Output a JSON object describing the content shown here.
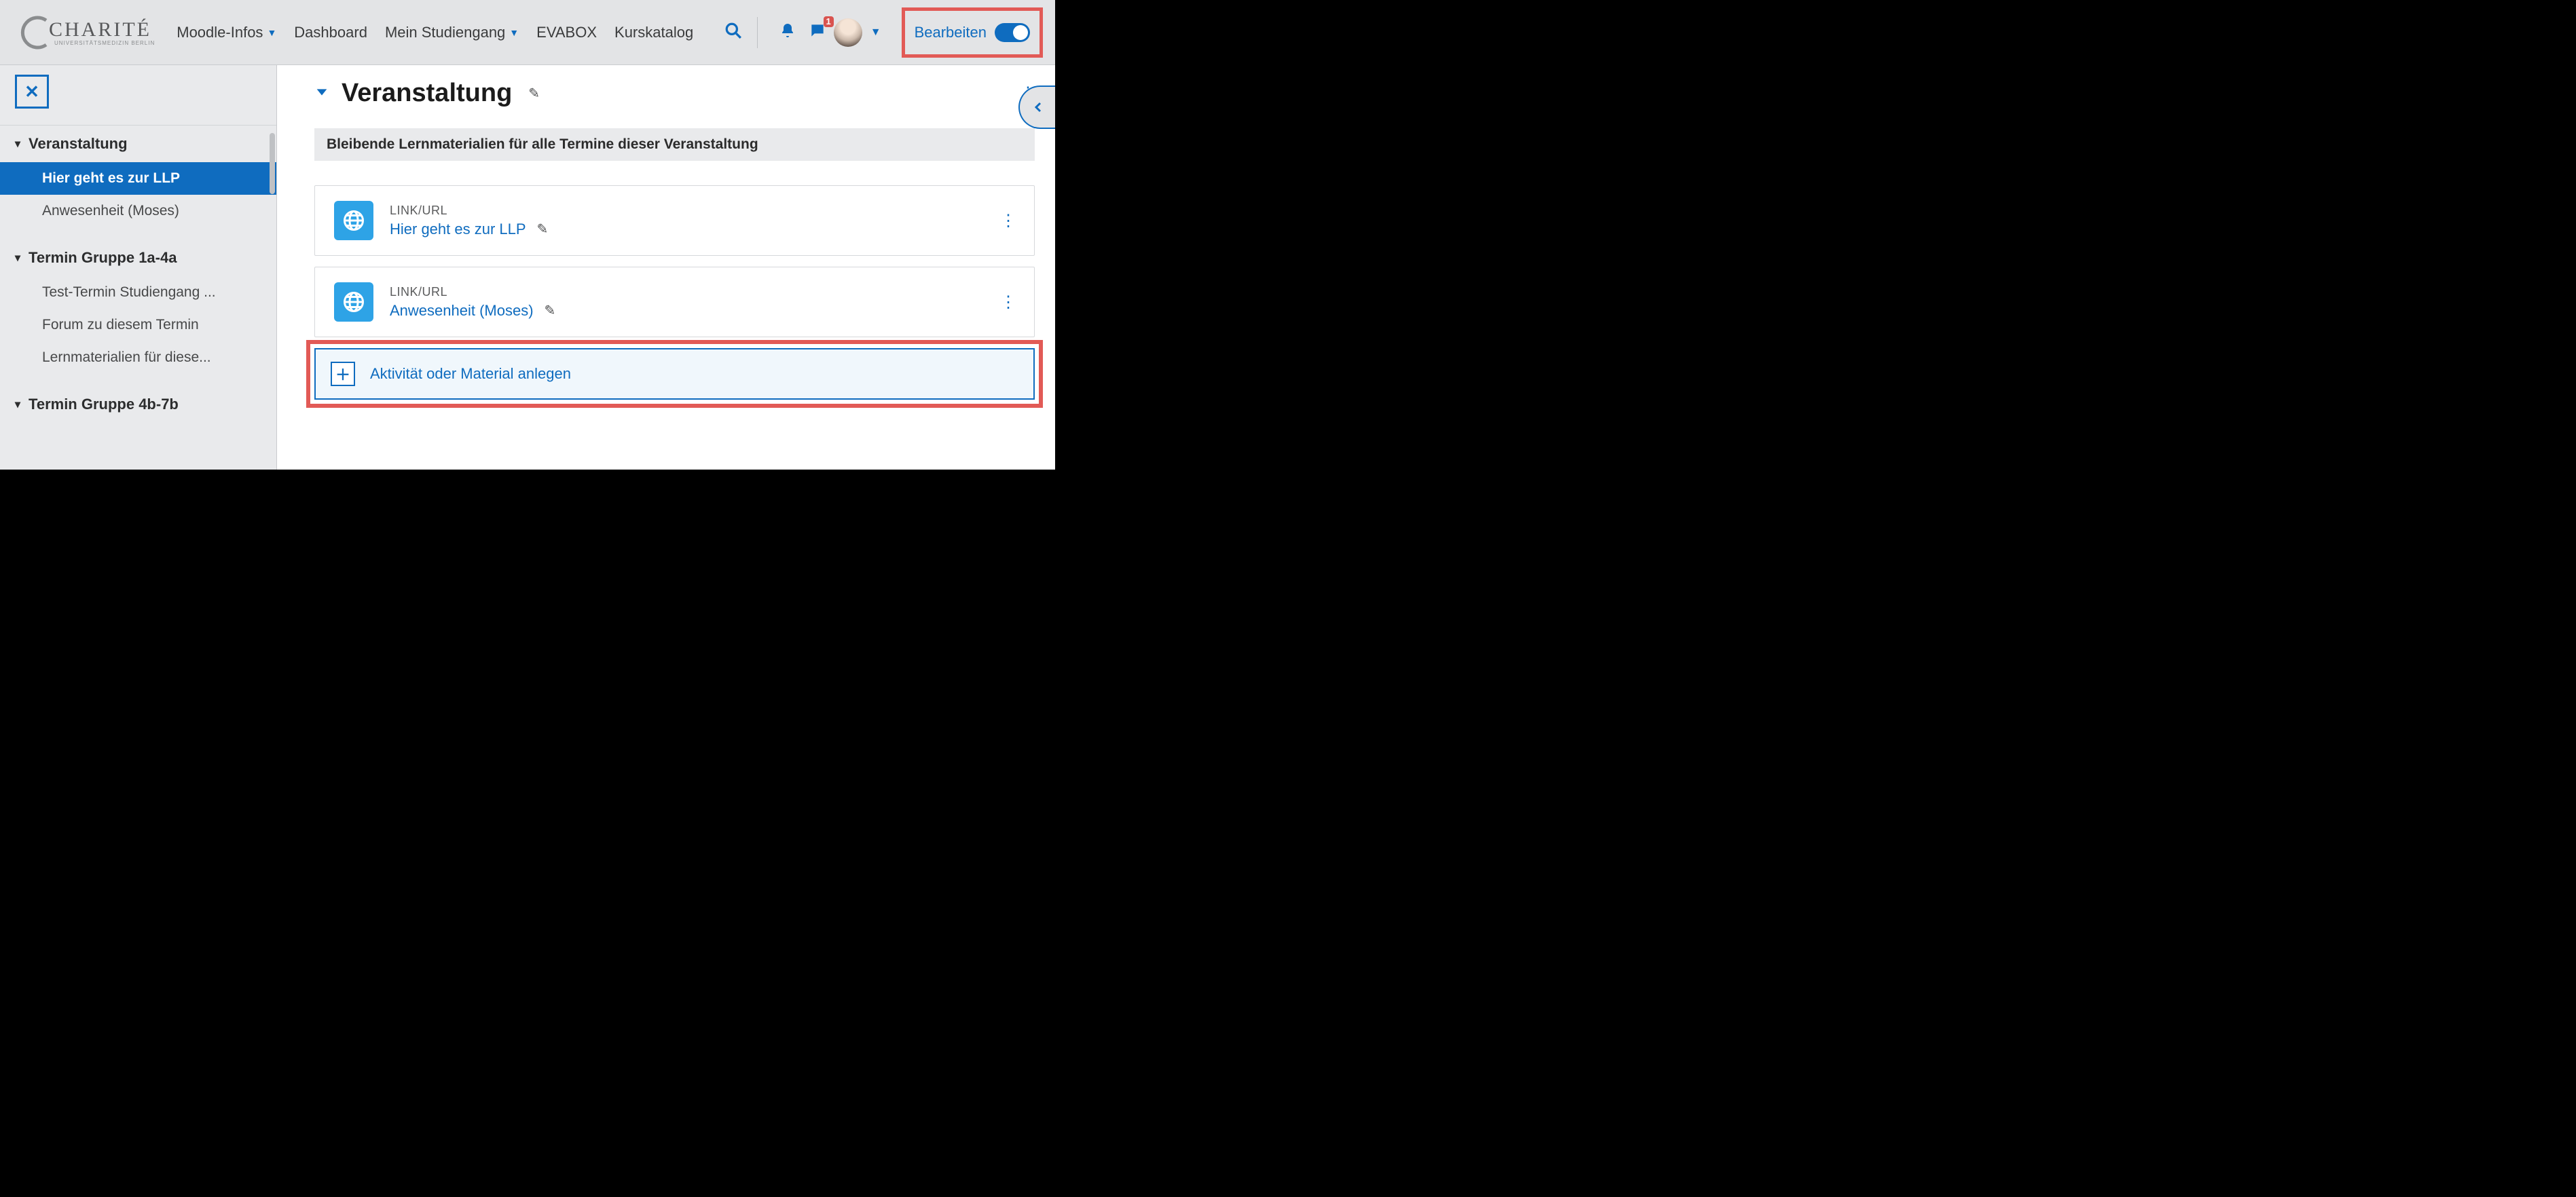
{
  "nav": {
    "logo_main": "CHARITÉ",
    "logo_sub": "UNIVERSITÄTSMEDIZIN BERLIN",
    "links": [
      {
        "label": "Moodle-Infos",
        "has_caret": true
      },
      {
        "label": "Dashboard",
        "has_caret": false
      },
      {
        "label": "Mein Studiengang",
        "has_caret": true
      },
      {
        "label": "EVABOX",
        "has_caret": false
      },
      {
        "label": "Kurskatalog",
        "has_caret": false
      }
    ],
    "message_badge": "1",
    "edit_label": "Bearbeiten",
    "edit_on": true
  },
  "sidebar": {
    "sections": [
      {
        "title": "Veranstaltung",
        "items": [
          {
            "label": "Hier geht es zur LLP",
            "active": true
          },
          {
            "label": "Anwesenheit (Moses)",
            "active": false
          }
        ]
      },
      {
        "title": "Termin Gruppe 1a-4a",
        "items": [
          {
            "label": "Test-Termin Studiengang ...",
            "active": false
          },
          {
            "label": "Forum zu diesem Termin",
            "active": false
          },
          {
            "label": "Lernmaterialien für diese...",
            "active": false
          }
        ]
      },
      {
        "title": "Termin Gruppe 4b-7b",
        "items": []
      }
    ]
  },
  "main": {
    "section_title": "Veranstaltung",
    "note": "Bleibende Lernmaterialien für alle Termine dieser Veranstaltung",
    "activities": [
      {
        "type_label": "LINK/URL",
        "title": "Hier geht es zur LLP"
      },
      {
        "type_label": "LINK/URL",
        "title": "Anwesenheit (Moses)"
      }
    ],
    "add_label": "Aktivität oder Material anlegen"
  }
}
